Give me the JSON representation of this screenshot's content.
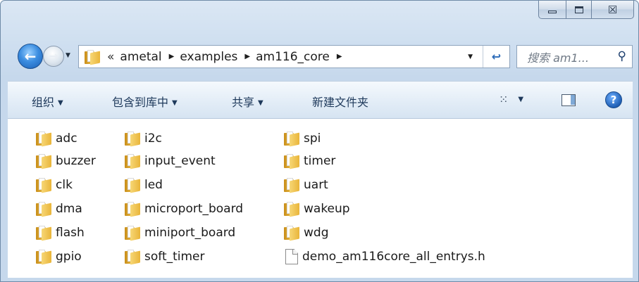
{
  "window": {
    "caption": {
      "minimize_icon": "minimize-icon",
      "maximize_icon": "maximize-icon",
      "close_glyph": "☒"
    }
  },
  "nav": {
    "back_glyph": "←",
    "forward_glyph": "→",
    "address": {
      "overflow": "«",
      "crumbs": [
        "ametal",
        "examples",
        "am116_core"
      ],
      "separator": "▶"
    },
    "refresh_glyph": "↩",
    "search": {
      "placeholder": "搜索 am1..."
    }
  },
  "toolbar": {
    "organize": "组织",
    "include_in_library": "包含到库中",
    "share": "共享",
    "new_folder": "新建文件夹",
    "caret": "▼",
    "help_glyph": "?"
  },
  "content": {
    "columns": [
      [
        "adc",
        "buzzer",
        "clk",
        "dma",
        "flash",
        "gpio"
      ],
      [
        "i2c",
        "input_event",
        "led",
        "microport_board",
        "miniport_board",
        "soft_timer"
      ],
      [
        "spi",
        "timer",
        "uart",
        "wakeup",
        "wdg"
      ]
    ],
    "file": "demo_am116core_all_entrys.h"
  },
  "colors": {
    "accent": "#1e395b",
    "folder": "#e9b53a",
    "frame": "#cfdff0"
  }
}
